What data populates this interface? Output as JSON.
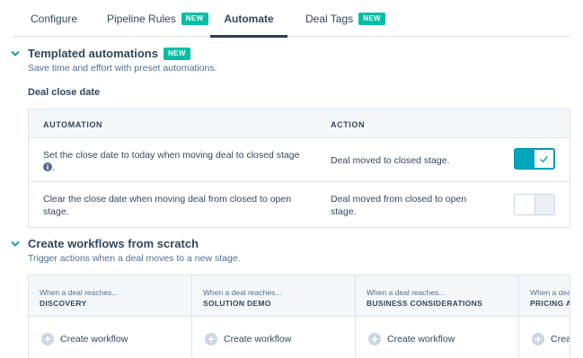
{
  "tabs": [
    {
      "label": "Configure",
      "badge": ""
    },
    {
      "label": "Pipeline Rules",
      "badge": "NEW"
    },
    {
      "label": "Automate",
      "badge": ""
    },
    {
      "label": "Deal Tags",
      "badge": "NEW"
    }
  ],
  "active_tab": "Automate",
  "templated": {
    "title": "Templated automations",
    "badge": "NEW",
    "subtitle": "Save time and effort with preset automations.",
    "group_title": "Deal close date",
    "columns": {
      "automation": "AUTOMATION",
      "action": "ACTION"
    },
    "rows": [
      {
        "automation": "Set the close date to today when moving deal to closed stage",
        "action": "Deal moved to closed stage.",
        "enabled": true
      },
      {
        "automation": "Clear the close date when moving deal from closed to open stage.",
        "action": "Deal moved from closed to open stage.",
        "enabled": false
      }
    ]
  },
  "workflows": {
    "title": "Create workflows from scratch",
    "subtitle": "Trigger actions when a deal moves to a new stage.",
    "stages": [
      {
        "pre": "When a deal reaches...",
        "name": "DISCOVERY",
        "action": "Create workflow"
      },
      {
        "pre": "When a deal reaches...",
        "name": "SOLUTION DEMO",
        "action": "Create workflow"
      },
      {
        "pre": "When a deal reaches...",
        "name": "BUSINESS CONSIDERATIONS",
        "action": "Create workflow"
      },
      {
        "pre": "When a deal reaches...",
        "name": "PRICING A",
        "action": "Create workflow"
      }
    ]
  },
  "icons": {
    "section_toggle": "chevron-down-icon",
    "info": "info-icon",
    "toggle_on": "check-icon",
    "create": "plus-circle-icon"
  },
  "colors": {
    "accent_teal": "#00a4bd",
    "badge_green": "#00bda5",
    "text": "#33475b",
    "header_bg": "#f5f8fa",
    "border": "#dfe3eb"
  }
}
